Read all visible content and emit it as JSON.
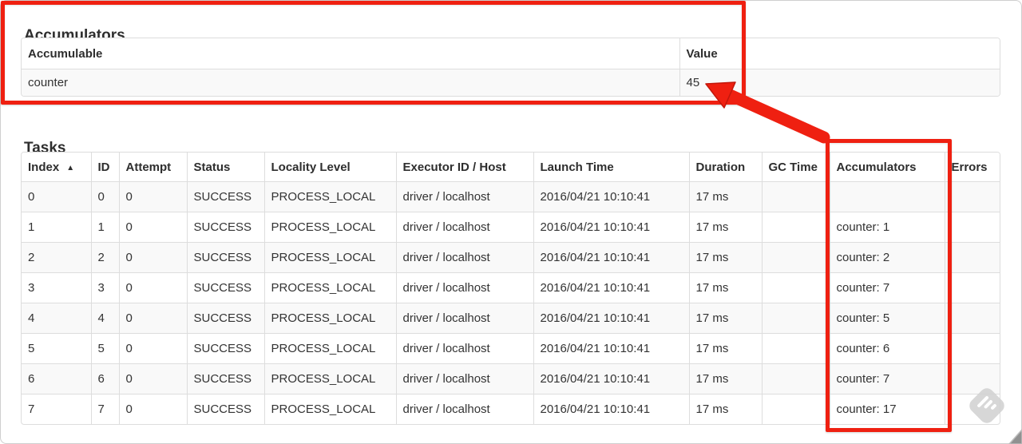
{
  "colors": {
    "annotation_red": "#ef2011",
    "table_border": "#dddddd",
    "row_stripe": "#f9f9f9",
    "text": "#333333"
  },
  "accumulators": {
    "title": "Accumulators",
    "table": {
      "headers": [
        "Accumulable",
        "Value"
      ],
      "rows": [
        [
          "counter",
          "45"
        ]
      ]
    }
  },
  "tasks": {
    "title": "Tasks",
    "sort_icon": "▲",
    "table": {
      "headers": [
        "Index",
        "ID",
        "Attempt",
        "Status",
        "Locality Level",
        "Executor ID / Host",
        "Launch Time",
        "Duration",
        "GC Time",
        "Accumulators",
        "Errors"
      ],
      "rows": [
        [
          "0",
          "0",
          "0",
          "SUCCESS",
          "PROCESS_LOCAL",
          "driver / localhost",
          "2016/04/21 10:10:41",
          "17 ms",
          "",
          "",
          ""
        ],
        [
          "1",
          "1",
          "0",
          "SUCCESS",
          "PROCESS_LOCAL",
          "driver / localhost",
          "2016/04/21 10:10:41",
          "17 ms",
          "",
          "counter: 1",
          ""
        ],
        [
          "2",
          "2",
          "0",
          "SUCCESS",
          "PROCESS_LOCAL",
          "driver / localhost",
          "2016/04/21 10:10:41",
          "17 ms",
          "",
          "counter: 2",
          ""
        ],
        [
          "3",
          "3",
          "0",
          "SUCCESS",
          "PROCESS_LOCAL",
          "driver / localhost",
          "2016/04/21 10:10:41",
          "17 ms",
          "",
          "counter: 7",
          ""
        ],
        [
          "4",
          "4",
          "0",
          "SUCCESS",
          "PROCESS_LOCAL",
          "driver / localhost",
          "2016/04/21 10:10:41",
          "17 ms",
          "",
          "counter: 5",
          ""
        ],
        [
          "5",
          "5",
          "0",
          "SUCCESS",
          "PROCESS_LOCAL",
          "driver / localhost",
          "2016/04/21 10:10:41",
          "17 ms",
          "",
          "counter: 6",
          ""
        ],
        [
          "6",
          "6",
          "0",
          "SUCCESS",
          "PROCESS_LOCAL",
          "driver / localhost",
          "2016/04/21 10:10:41",
          "17 ms",
          "",
          "counter: 7",
          ""
        ],
        [
          "7",
          "7",
          "0",
          "SUCCESS",
          "PROCESS_LOCAL",
          "driver / localhost",
          "2016/04/21 10:10:41",
          "17 ms",
          "",
          "counter: 17",
          ""
        ]
      ]
    }
  }
}
